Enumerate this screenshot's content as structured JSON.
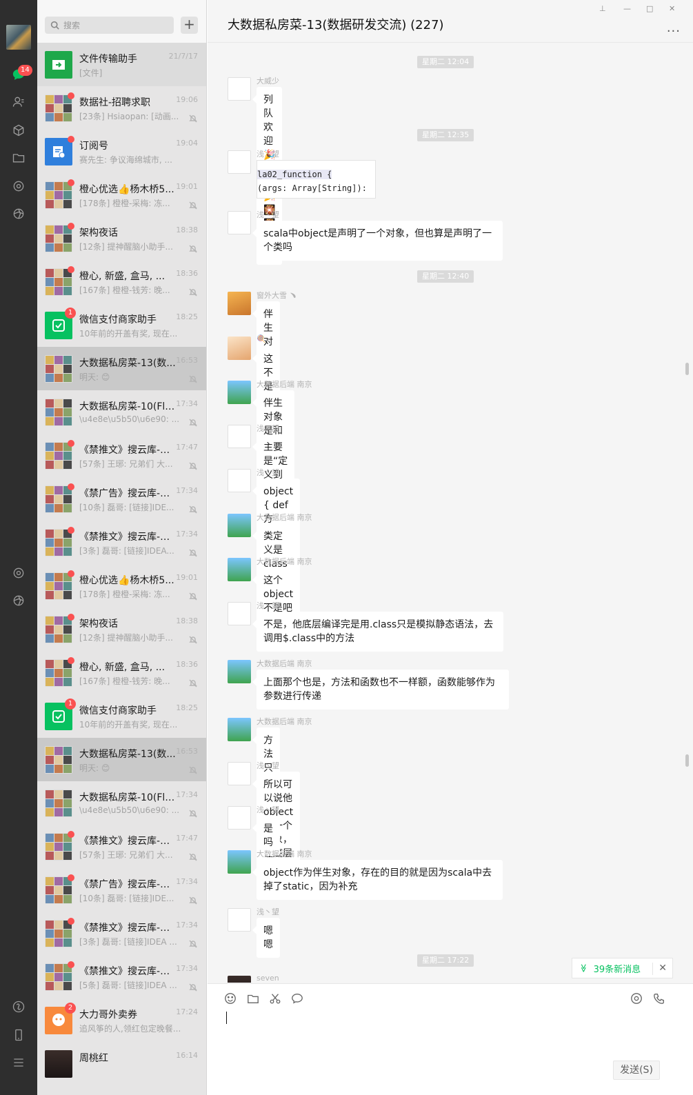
{
  "nav": {
    "badge": "14"
  },
  "search": {
    "placeholder": "搜索"
  },
  "add_label": "+",
  "chats": [
    {
      "name": "文件传输助手",
      "time": "21/7/17",
      "preview": "[文件]"
    },
    {
      "name": "数据社-招聘求职",
      "time": "19:06",
      "preview": "[23条] Hsiaopan: [动画..."
    },
    {
      "name": "订阅号",
      "time": "19:04",
      "preview": "赛先生: 争议海绵城市, ..."
    },
    {
      "name": "橙心优选👍杨木桥5...",
      "time": "19:01",
      "preview": "[178条] 橙橙-采梅: 冻..."
    },
    {
      "name": "架构夜话",
      "time": "18:38",
      "preview": "[12条] 提神醒脑小助手..."
    },
    {
      "name": "橙心, 新盛, 盒马, ...",
      "time": "18:36",
      "preview": "[167条] 橙橙-钱芳: 晚..."
    },
    {
      "name": "微信支付商家助手",
      "time": "18:25",
      "preview": "10年前的开盖有奖, 现在...",
      "badge": "1"
    },
    {
      "name": "大数据私房菜-13(数...",
      "time": "16:53",
      "preview": "明天: 😊"
    },
    {
      "name": "大数据私房菜-10(Fli...",
      "time": "17:34",
      "preview": "\\u4e8e\\u5b50\\u6e90: ..."
    },
    {
      "name": "《禁推文》搜云库-技...",
      "time": "17:47",
      "preview": "[57条] 王琊: 兄弟们 大..."
    },
    {
      "name": "《禁广告》搜云库-技...",
      "time": "17:34",
      "preview": "[10条] 磊哥: [链接]IDE..."
    },
    {
      "name": "《禁推文》搜云库-技...",
      "time": "17:34",
      "preview": "[3条] 磊哥: [链接]IDEA..."
    },
    {
      "name": "橙心优选👍杨木桥5...",
      "time": "19:01",
      "preview": "[178条] 橙橙-采梅: 冻..."
    },
    {
      "name": "架构夜话",
      "time": "18:38",
      "preview": "[12条] 提神醒脑小助手..."
    },
    {
      "name": "橙心, 新盛, 盒马, ...",
      "time": "18:36",
      "preview": "[167条] 橙橙-钱芳: 晚..."
    },
    {
      "name": "微信支付商家助手",
      "time": "18:25",
      "preview": "10年前的开盖有奖, 现在...",
      "badge": "1"
    },
    {
      "name": "大数据私房菜-13(数...",
      "time": "16:53",
      "preview": "明天: 😊"
    },
    {
      "name": "大数据私房菜-10(Fli...",
      "time": "17:34",
      "preview": "\\u4e8e\\u5b50\\u6e90: ..."
    },
    {
      "name": "《禁推文》搜云库-技...",
      "time": "17:47",
      "preview": "[57条] 王琊: 兄弟们 大..."
    },
    {
      "name": "《禁广告》搜云库-技...",
      "time": "17:34",
      "preview": "[10条] 磊哥: [链接]IDE..."
    },
    {
      "name": "《禁推文》搜云库-技...",
      "time": "17:34",
      "preview": "[3条] 磊哥: [链接]IDEA ..."
    },
    {
      "name": "《禁推文》搜云库-技...",
      "time": "17:34",
      "preview": "[5条] 磊哥: [链接]IDEA ..."
    },
    {
      "name": "大力哥外卖券",
      "time": "17:24",
      "preview": "追风筝的人,领红包定晚餐...",
      "badge": "2"
    },
    {
      "name": "周桃红",
      "time": "16:14",
      "preview": ""
    }
  ],
  "header": {
    "title": "大数据私房菜-13(数据研发交流) (227)",
    "more": "...",
    "win": [
      "⊥",
      "—",
      "□",
      "✕"
    ]
  },
  "times": [
    "星期二 12:04",
    "星期二 12:35",
    "星期二 12:40",
    "星期二 17:22"
  ],
  "messages": [
    {
      "sender": "大威少",
      "text": "列队欢迎🎉🎉🎉🎉🎇🎇🎇🎇"
    },
    {
      "sender": "浅丶望",
      "code": [
        "la02_function {",
        "(args: Array[String]): U"
      ]
    },
    {
      "sender": "浅丶望",
      "text": "scala中object是声明了一个对象，但也算是声明了一个类吗"
    },
    {
      "sender": "窗外大雪 ﹅",
      "text": "伴生对象"
    },
    {
      "sender": "🍭",
      "text": "这不是伴生对象吧"
    },
    {
      "sender": "大数据后端  南京",
      "text": "伴生对象是和class定义放在一起额"
    },
    {
      "sender": "浅丶望",
      "text": "主要是“定义到类中的函数就是方法”"
    },
    {
      "sender": "浅丶望",
      "text": "object  {   def 方法}，那外面相当于类了把"
    },
    {
      "sender": "大数据后端  南京",
      "text": "类定义是class"
    },
    {
      "sender": "大数据后端  南京",
      "text": "这个object不是吧"
    },
    {
      "sender": "浅丶望",
      "text": "不是，他底层编译完是用.class只是模拟静态语法，去调用$.class中的方法"
    },
    {
      "sender": "大数据后端  南京",
      "text": "上面那个也是，方法和函数也不一样额，函数能够作为参数进行传递"
    },
    {
      "sender": "大数据后端  南京",
      "text": "方法只是在类中定义"
    },
    {
      "sender": "浅丶望",
      "text": "所以可以说他object了一个对象，在底层编译中形成类"
    },
    {
      "sender": "浅丶望",
      "text": "是吗"
    },
    {
      "sender": "大数据后端  南京",
      "text": "object作为伴生对象，存在的目的就是因为scala中去掉了static，因为补充"
    },
    {
      "sender": "浅丶望",
      "text": "嗯嗯"
    },
    {
      "sender": "seven",
      "text": ""
    }
  ],
  "newmsg": {
    "label": "39条新消息",
    "close": "✕",
    "arrow": "≫"
  },
  "send": {
    "label": "发送(S)"
  },
  "colors": {
    "accent": "#07c160",
    "badge": "#fa5151"
  }
}
